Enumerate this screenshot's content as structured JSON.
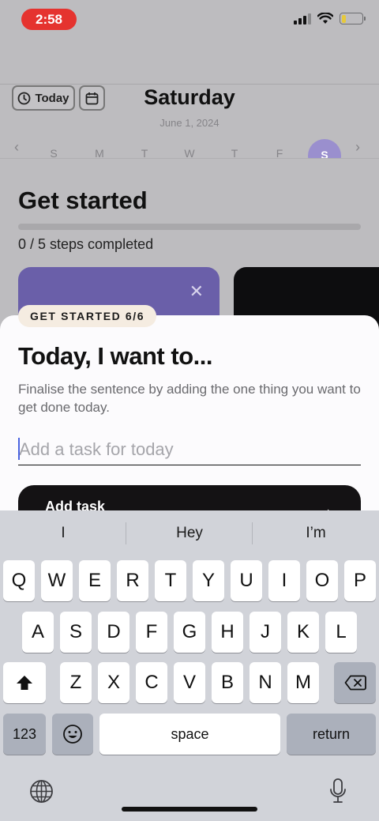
{
  "status": {
    "time": "2:58"
  },
  "header": {
    "today_label": "Today",
    "day": "Saturday",
    "date": "June 1, 2024"
  },
  "week": {
    "days": [
      "S",
      "M",
      "T",
      "W",
      "T",
      "F"
    ],
    "selected": "S"
  },
  "get_started": {
    "title": "Get started",
    "steps_text": "0 / 5 steps completed",
    "progress": 0
  },
  "sheet": {
    "badge": "GET STARTED 6/6",
    "title": "Today, I want to...",
    "description": "Finalise the sentence by adding the one thing you want to get done today.",
    "input_placeholder": "Add a task for today",
    "input_value": "",
    "add_button": "Add task"
  },
  "keyboard": {
    "suggestions": [
      "I",
      "Hey",
      "I’m"
    ],
    "row1": [
      "Q",
      "W",
      "E",
      "R",
      "T",
      "Y",
      "U",
      "I",
      "O",
      "P"
    ],
    "row2": [
      "A",
      "S",
      "D",
      "F",
      "G",
      "H",
      "J",
      "K",
      "L"
    ],
    "row3": [
      "Z",
      "X",
      "C",
      "V",
      "B",
      "N",
      "M"
    ],
    "numbers": "123",
    "space": "space",
    "return": "return"
  },
  "colors": {
    "accent_purple": "#6a5fa9",
    "status_red": "#e5332f",
    "badge_bg": "#f5ece1"
  }
}
